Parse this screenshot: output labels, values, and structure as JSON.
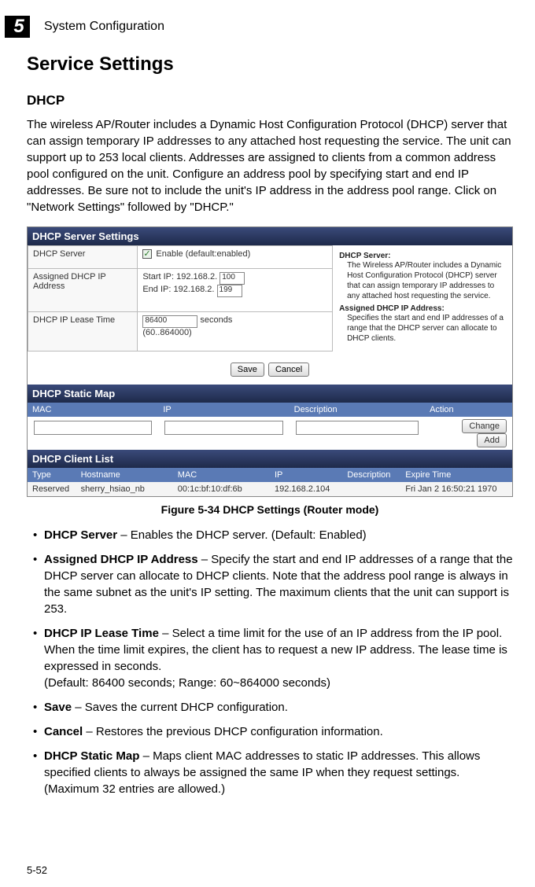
{
  "chapter": {
    "number": "5",
    "title": "System Configuration"
  },
  "h1": "Service Settings",
  "h2": "DHCP",
  "intro": "The wireless AP/Router includes a Dynamic Host Configuration Protocol (DHCP) server that can assign temporary IP addresses to any attached host requesting the service. The unit can support up to 253 local clients. Addresses are assigned to clients from a common address pool configured on the unit. Configure an address pool by specifying start and end IP addresses. Be sure not to include the unit's IP address in the address pool range. Click on \"Network Settings\" followed by \"DHCP.\"",
  "figure": {
    "panel1_title": "DHCP Server Settings",
    "rows": {
      "r1_label": "DHCP Server",
      "r1_value_suffix": "Enable (default:enabled)",
      "r2_label": "Assigned DHCP IP Address",
      "r2_start_prefix": "Start IP: 192.168.2.",
      "r2_start_val": "100",
      "r2_end_prefix": "End IP: 192.168.2.",
      "r2_end_val": "199",
      "r3_label": "DHCP IP Lease Time",
      "r3_val": "86400",
      "r3_suffix": "seconds",
      "r3_hint": "(60..864000)"
    },
    "help": {
      "t1": "DHCP Server:",
      "p1": "The Wireless AP/Router includes a Dynamic Host Configuration Protocol (DHCP) server that can assign temporary IP addresses to any attached host requesting the service.",
      "t2": "Assigned DHCP IP Address:",
      "p2": "Specifies the start and end IP addresses of a range that the DHCP server can allocate to DHCP clients."
    },
    "save": "Save",
    "cancel": "Cancel",
    "panel2_title": "DHCP Static Map",
    "static_cols": {
      "c1": "MAC",
      "c2": "IP",
      "c3": "Description",
      "c4": "Action"
    },
    "change": "Change",
    "add": "Add",
    "panel3_title": "DHCP Client List",
    "client_cols": {
      "c1": "Type",
      "c2": "Hostname",
      "c3": "MAC",
      "c4": "IP",
      "c5": "Description",
      "c6": "Expire Time"
    },
    "client_row": {
      "type": "Reserved",
      "host": "sherry_hsiao_nb",
      "mac": "00:1c:bf:10:df:6b",
      "ip": "192.168.2.104",
      "desc": "",
      "expire": "Fri Jan 2 16:50:21 1970"
    }
  },
  "caption": "Figure 5-34  DHCP Settings (Router mode)",
  "bullets": [
    {
      "term": "DHCP Server",
      "text": " – Enables the DHCP server. (Default: Enabled)"
    },
    {
      "term": "Assigned DHCP IP Address",
      "text": " – Specify the start and end IP addresses of a range that the DHCP server can allocate to DHCP clients. Note that the address pool range is always in the same subnet as the unit's IP setting. The maximum clients that the unit can support is 253."
    },
    {
      "term": "DHCP IP Lease Time",
      "text": " – Select a time limit for the use of an IP address from the IP pool. When the time limit expires, the client has to request a new IP address. The lease time is expressed in seconds.\n(Default: 86400 seconds; Range: 60~864000 seconds)"
    },
    {
      "term": "Save",
      "text": " – Saves the current DHCP configuration."
    },
    {
      "term": "Cancel",
      "text": " – Restores the previous DHCP configuration information."
    },
    {
      "term": "DHCP Static Map",
      "text": " – Maps client MAC addresses to static IP addresses. This allows specified clients to always be assigned the same IP when they request settings. (Maximum 32 entries are allowed.)"
    }
  ],
  "page_num": "5-52"
}
